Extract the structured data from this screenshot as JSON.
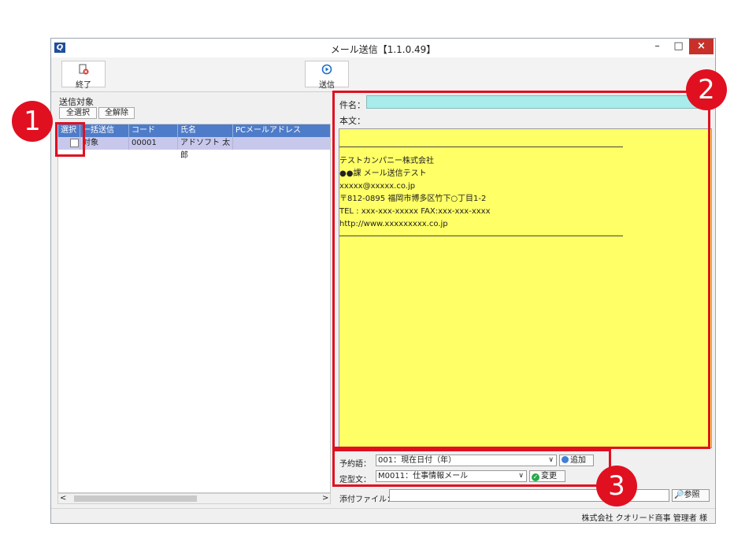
{
  "window": {
    "title": "メール送信【1.1.0.49】",
    "app_logo": "Q",
    "minimize": "–",
    "maximize": "□",
    "close": "×"
  },
  "toolbar": {
    "exit_label": "終了",
    "send_label": "送信"
  },
  "targets": {
    "label": "送信対象",
    "select_all": "全選択",
    "deselect_all": "全解除",
    "columns": [
      "選択",
      "一括送信",
      "コード",
      "氏名",
      "PCメールアドレス"
    ],
    "rows": [
      {
        "checked": false,
        "bulk": "対象",
        "code": "00001",
        "name": "アドソフト 太郎",
        "email": ""
      }
    ],
    "scroll_left": "<",
    "scroll_right": ">"
  },
  "mail": {
    "subject_label": "件名：",
    "subject_value": "",
    "body_label": "本文：",
    "signature": [
      "テストカンパニー株式会社",
      "●●課 メール送信テスト",
      "xxxxx@xxxxx.co.jp",
      "〒812-0895 福岡市博多区竹下○丁目1-2",
      "TEL : xxx-xxx-xxxxx FAX:xxx-xxx-xxxx",
      "http://www.xxxxxxxxx.co.jp"
    ]
  },
  "options": {
    "reserved_label": "予約語：",
    "reserved_value": "001：現在日付（年）",
    "add_label": "追加",
    "template_label": "定型文：",
    "template_value": "M0011：仕事情報メール",
    "change_label": "変更",
    "attach_label": "添付ファイル：",
    "attach_value": "",
    "browse_label": "参照"
  },
  "status": {
    "text": "株式会社 クオリード商事 管理者 様"
  },
  "markers": [
    "1",
    "2",
    "3"
  ],
  "colors": {
    "annotation": "#e01020",
    "header": "#4e7cc8",
    "selected_row": "#c8c8ec",
    "body_bg": "#ffff66",
    "subject_bg": "#a8ecec"
  }
}
